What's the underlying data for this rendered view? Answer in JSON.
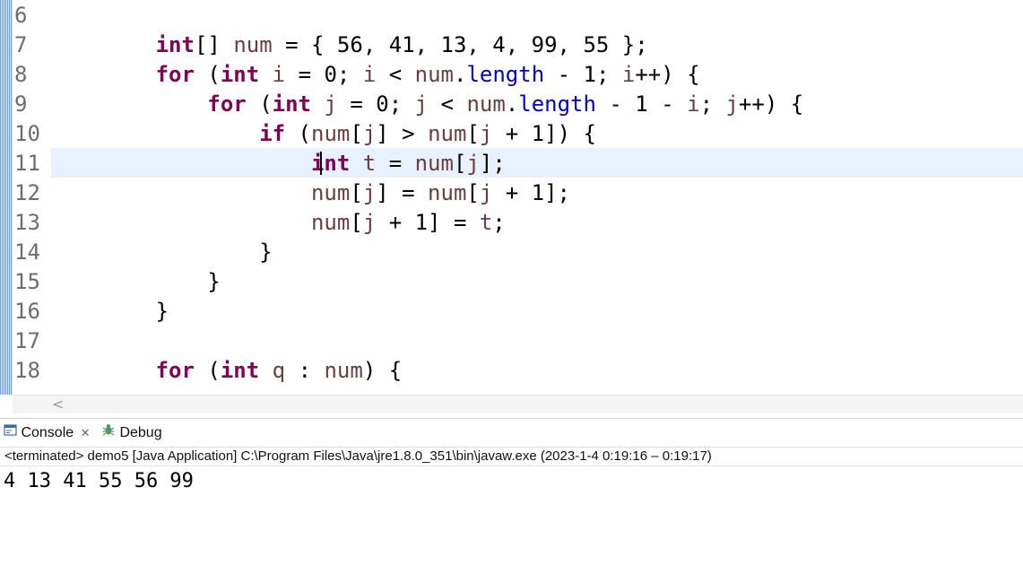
{
  "editor": {
    "lines": [
      {
        "num": "6",
        "tokens": []
      },
      {
        "num": "7",
        "tokens": [
          {
            "t": "        "
          },
          {
            "t": "int",
            "c": "kw"
          },
          {
            "t": "[] "
          },
          {
            "t": "num",
            "c": "var"
          },
          {
            "t": " = { 56, 41, 13, 4, 99, 55 };"
          }
        ]
      },
      {
        "num": "8",
        "tokens": [
          {
            "t": "        "
          },
          {
            "t": "for",
            "c": "kw"
          },
          {
            "t": " ("
          },
          {
            "t": "int",
            "c": "kw"
          },
          {
            "t": " "
          },
          {
            "t": "i",
            "c": "var"
          },
          {
            "t": " = 0; "
          },
          {
            "t": "i",
            "c": "var"
          },
          {
            "t": " < "
          },
          {
            "t": "num",
            "c": "var"
          },
          {
            "t": "."
          },
          {
            "t": "length",
            "c": "fld"
          },
          {
            "t": " - 1; "
          },
          {
            "t": "i",
            "c": "var"
          },
          {
            "t": "++) {"
          }
        ]
      },
      {
        "num": "9",
        "tokens": [
          {
            "t": "            "
          },
          {
            "t": "for",
            "c": "kw"
          },
          {
            "t": " ("
          },
          {
            "t": "int",
            "c": "kw"
          },
          {
            "t": " "
          },
          {
            "t": "j",
            "c": "var"
          },
          {
            "t": " = 0; "
          },
          {
            "t": "j",
            "c": "var"
          },
          {
            "t": " < "
          },
          {
            "t": "num",
            "c": "var"
          },
          {
            "t": "."
          },
          {
            "t": "length",
            "c": "fld"
          },
          {
            "t": " - 1 - "
          },
          {
            "t": "i",
            "c": "var"
          },
          {
            "t": "; "
          },
          {
            "t": "j",
            "c": "var"
          },
          {
            "t": "++) {"
          }
        ]
      },
      {
        "num": "10",
        "tokens": [
          {
            "t": "                "
          },
          {
            "t": "if",
            "c": "kw"
          },
          {
            "t": " ("
          },
          {
            "t": "num",
            "c": "var"
          },
          {
            "t": "["
          },
          {
            "t": "j",
            "c": "var"
          },
          {
            "t": "] > "
          },
          {
            "t": "num",
            "c": "var"
          },
          {
            "t": "["
          },
          {
            "t": "j",
            "c": "var"
          },
          {
            "t": " + 1]) {"
          }
        ]
      },
      {
        "num": "11",
        "tokens": [
          {
            "t": "                    "
          },
          {
            "t": "int",
            "c": "kw"
          },
          {
            "t": " "
          },
          {
            "t": "t",
            "c": "var"
          },
          {
            "t": " = "
          },
          {
            "t": "num",
            "c": "var"
          },
          {
            "t": "["
          },
          {
            "t": "j",
            "c": "var"
          },
          {
            "t": "];"
          }
        ]
      },
      {
        "num": "12",
        "tokens": [
          {
            "t": "                    "
          },
          {
            "t": "num",
            "c": "var"
          },
          {
            "t": "["
          },
          {
            "t": "j",
            "c": "var"
          },
          {
            "t": "] = "
          },
          {
            "t": "num",
            "c": "var"
          },
          {
            "t": "["
          },
          {
            "t": "j",
            "c": "var"
          },
          {
            "t": " + 1];"
          }
        ]
      },
      {
        "num": "13",
        "tokens": [
          {
            "t": "                    "
          },
          {
            "t": "num",
            "c": "var"
          },
          {
            "t": "["
          },
          {
            "t": "j",
            "c": "var"
          },
          {
            "t": " + 1] = "
          },
          {
            "t": "t",
            "c": "var"
          },
          {
            "t": ";"
          }
        ]
      },
      {
        "num": "14",
        "tokens": [
          {
            "t": "                }"
          }
        ]
      },
      {
        "num": "15",
        "tokens": [
          {
            "t": "            }"
          }
        ]
      },
      {
        "num": "16",
        "tokens": [
          {
            "t": "        }"
          }
        ]
      },
      {
        "num": "17",
        "tokens": []
      },
      {
        "num": "18",
        "tokens": [
          {
            "t": "        "
          },
          {
            "t": "for",
            "c": "kw"
          },
          {
            "t": " ("
          },
          {
            "t": "int",
            "c": "kw"
          },
          {
            "t": " "
          },
          {
            "t": "q",
            "c": "var"
          },
          {
            "t": " : "
          },
          {
            "t": "num",
            "c": "var"
          },
          {
            "t": ") {"
          }
        ]
      }
    ],
    "current_line": "11"
  },
  "colors": {
    "keyword": "#7f0055",
    "variable": "#6a3e3e",
    "field": "#0000c0",
    "current_line_highlight": "#e8f2fe"
  },
  "hscroll": {
    "left_arrow": "<"
  },
  "console": {
    "tabs": [
      {
        "label": "Console",
        "icon": "console-icon",
        "close": "✕"
      },
      {
        "label": "Debug",
        "icon": "debug-icon"
      }
    ],
    "header": "<terminated> demo5 [Java Application] C:\\Program Files\\Java\\jre1.8.0_351\\bin\\javaw.exe  (2023-1-4 0:19:16 – 0:19:17)",
    "output": "4 13 41 55 56 99"
  }
}
